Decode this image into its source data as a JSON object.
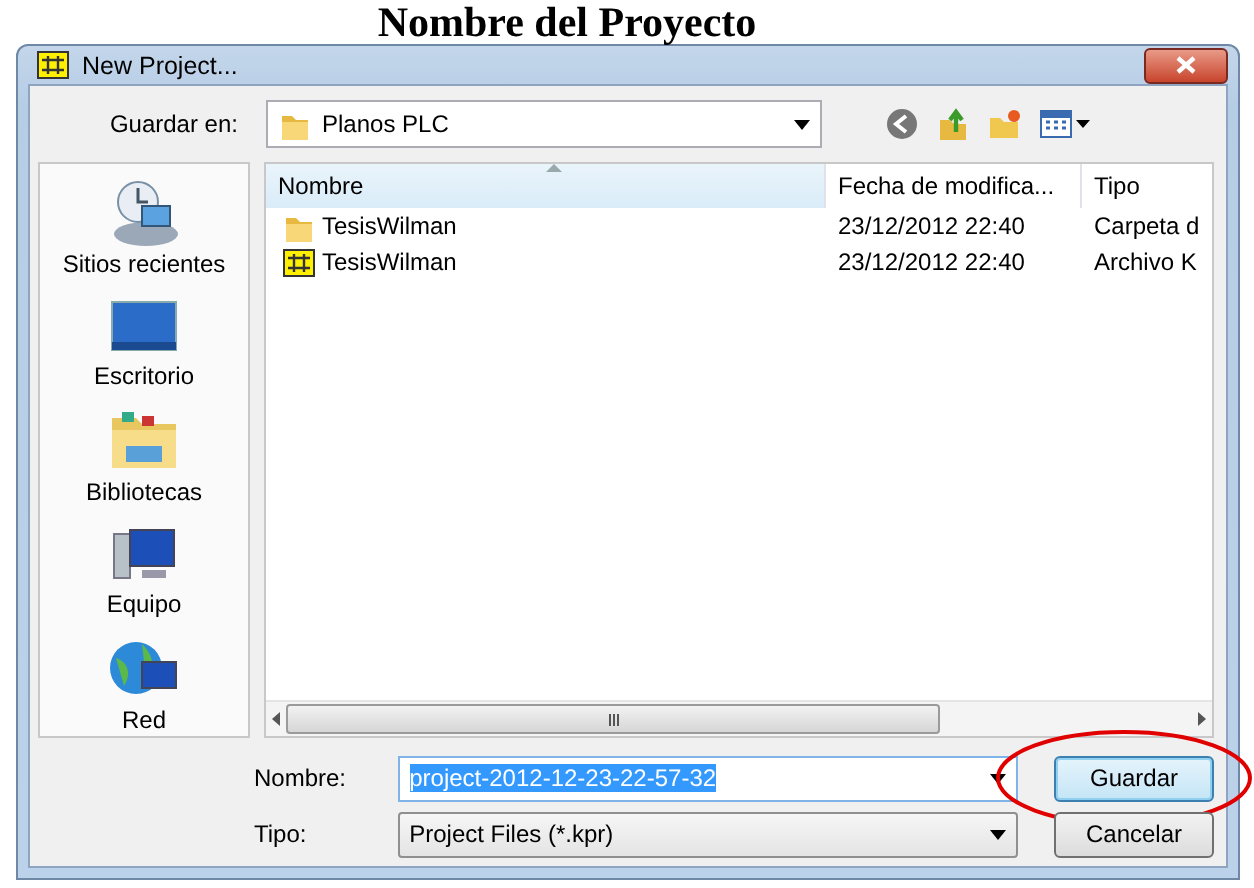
{
  "caption": "Nombre del Proyecto",
  "window": {
    "title": "New Project..."
  },
  "location": {
    "label": "Guardar en:",
    "value": "Planos PLC"
  },
  "places": [
    {
      "label": "Sitios recientes",
      "kind": "recent"
    },
    {
      "label": "Escritorio",
      "kind": "desktop"
    },
    {
      "label": "Bibliotecas",
      "kind": "libraries"
    },
    {
      "label": "Equipo",
      "kind": "computer"
    },
    {
      "label": "Red",
      "kind": "network"
    }
  ],
  "file_list": {
    "columns": [
      {
        "label": "Nombre",
        "sorted": true
      },
      {
        "label": "Fecha de modifica...",
        "sorted": false
      },
      {
        "label": "Tipo",
        "sorted": false
      }
    ],
    "rows": [
      {
        "kind": "folder",
        "name": "TesisWilman",
        "date": "23/12/2012 22:40",
        "type": "Carpeta d"
      },
      {
        "kind": "project",
        "name": "TesisWilman",
        "date": "23/12/2012 22:40",
        "type": "Archivo K"
      }
    ]
  },
  "filename": {
    "label": "Nombre:",
    "value": "project-2012-12-23-22-57-32",
    "selected": true
  },
  "filetype": {
    "label": "Tipo:",
    "value": "Project Files (*.kpr)"
  },
  "buttons": [
    {
      "label": "Guardar",
      "kind": "default",
      "circled": true
    },
    {
      "label": "Cancelar",
      "kind": "normal",
      "circled": false
    }
  ]
}
